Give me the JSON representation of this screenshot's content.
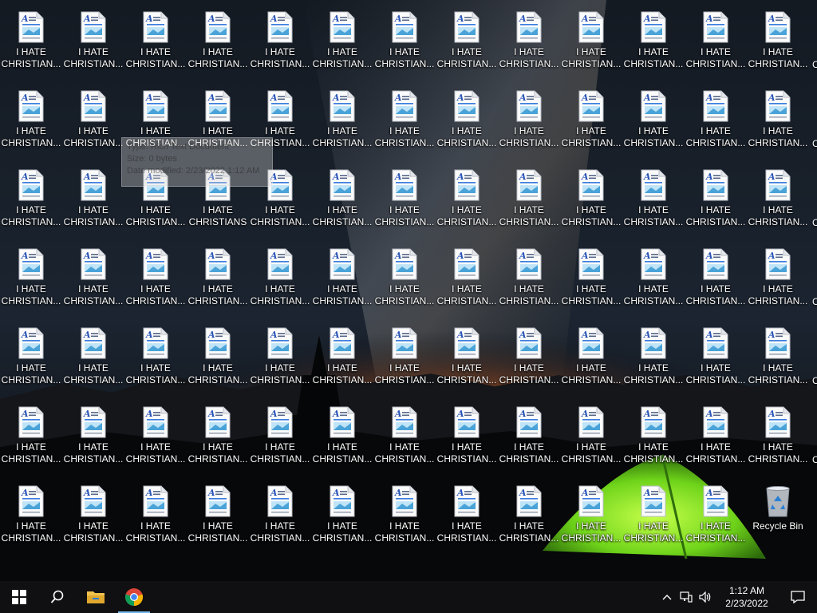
{
  "desktop": {
    "file_label_line1": "I HATE",
    "file_label_line2_truncated": "CHRISTIAN...",
    "file_label_line2_full": "CHRISTIANS",
    "columns": 13,
    "rows": 7,
    "hovered_file": {
      "row": 2,
      "col": 3
    },
    "recycle_bin": {
      "label": "Recycle Bin",
      "icon": "recycle-bin-icon"
    },
    "file_icon": "wordpad-document-icon"
  },
  "tooltip": {
    "line1": "Type: Rich Text Document",
    "line2": "Size: 0 bytes",
    "line3": "Date modified: 2/23/2022 1:12 AM"
  },
  "taskbar": {
    "start": "windows-start-icon",
    "search": "search-icon",
    "pinned": [
      {
        "name": "file-explorer",
        "icon": "folder-icon"
      },
      {
        "name": "chrome",
        "icon": "chrome-icon",
        "active": true
      }
    ],
    "tray": {
      "chevron": "chevron-up-icon",
      "network": "network-icon",
      "volume": "volume-icon",
      "time": "1:12 AM",
      "date": "2/23/2022",
      "notifications": "action-center-icon"
    }
  },
  "colors": {
    "taskbar": "#101012",
    "active_indicator": "#76b9ed",
    "tent_green": "#7fe21a",
    "horizon_orange": "#e2661c"
  }
}
